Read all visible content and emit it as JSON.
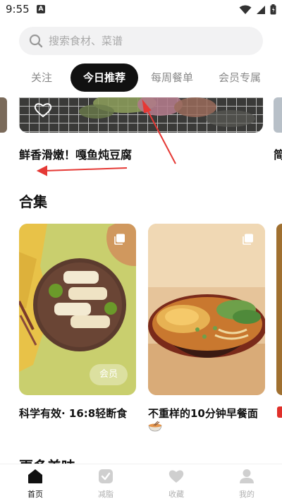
{
  "status_bar": {
    "time": "9:55",
    "notification_letter": "A"
  },
  "search": {
    "placeholder": "搜索食材、菜谱"
  },
  "tabs": [
    {
      "label": "关注",
      "active": false
    },
    {
      "label": "今日推荐",
      "active": true
    },
    {
      "label": "每周餐单",
      "active": false
    },
    {
      "label": "会员专属",
      "active": false
    }
  ],
  "hero": {
    "title": "鲜香滑嫩！嘎鱼炖豆腐",
    "next_title_partial": "简"
  },
  "collection": {
    "title": "合集",
    "cards": [
      {
        "title": "科学有效· 16:8轻断食",
        "badge": "会员"
      },
      {
        "title": "不重样的10分钟早餐面"
      }
    ]
  },
  "more_section": {
    "title": "更多美味"
  },
  "bottom_nav": [
    {
      "label": "首页",
      "icon": "home-icon",
      "active": true
    },
    {
      "label": "减脂",
      "icon": "shield-check-icon",
      "active": false
    },
    {
      "label": "收藏",
      "icon": "heart-icon",
      "active": false
    },
    {
      "label": "我的",
      "icon": "person-icon",
      "active": false
    }
  ],
  "colors": {
    "accent": "#111111",
    "inactive": "#b0b0b0",
    "annotation": "#e53935"
  }
}
